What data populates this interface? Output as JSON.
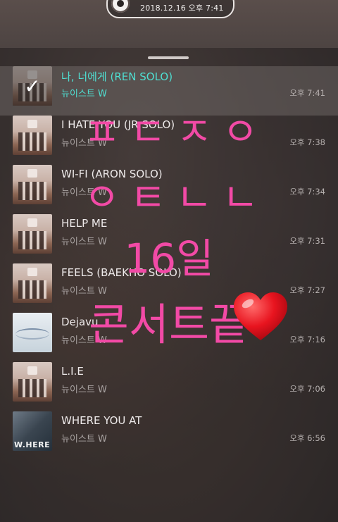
{
  "status": {
    "datetime": "2018.12.16 오후 7:41"
  },
  "tracks": [
    {
      "title": "나, 너에게 (REN SOLO)",
      "artist": "뉴이스트 W",
      "time": "오후 7:41",
      "active": true,
      "art": "album"
    },
    {
      "title": "I HATE YOU (JR SOLO)",
      "artist": "뉴이스트 W",
      "time": "오후 7:38",
      "art": "album"
    },
    {
      "title": "WI-FI (ARON SOLO)",
      "artist": "뉴이스트 W",
      "time": "오후 7:34",
      "art": "album"
    },
    {
      "title": "HELP ME",
      "artist": "뉴이스트 W",
      "time": "오후 7:31",
      "art": "album"
    },
    {
      "title": "FEELS (BAEKHO SOLO)",
      "artist": "뉴이스트 W",
      "time": "오후 7:27",
      "art": "album"
    },
    {
      "title": "Dejavu",
      "artist": "뉴이스트 W",
      "time": "오후 7:16",
      "art": "dejavu"
    },
    {
      "title": "L.I.E",
      "artist": "뉴이스트 W",
      "time": "오후 7:06",
      "art": "album"
    },
    {
      "title": "WHERE YOU AT",
      "artist": "뉴이스트 W",
      "time": "오후 6:56",
      "art": "where"
    }
  ],
  "overlay": {
    "line1": "ㅍㄷㅈㅇ",
    "line2": "ㅇㅌㄴㄴ",
    "line3": "16일",
    "line4": "콘서트끝"
  },
  "art_labels": {
    "where": "W.HERE"
  },
  "colors": {
    "active_text": "#4fdfd2",
    "overlay_pink": "#f24aa6",
    "heart": "#e8141f"
  }
}
